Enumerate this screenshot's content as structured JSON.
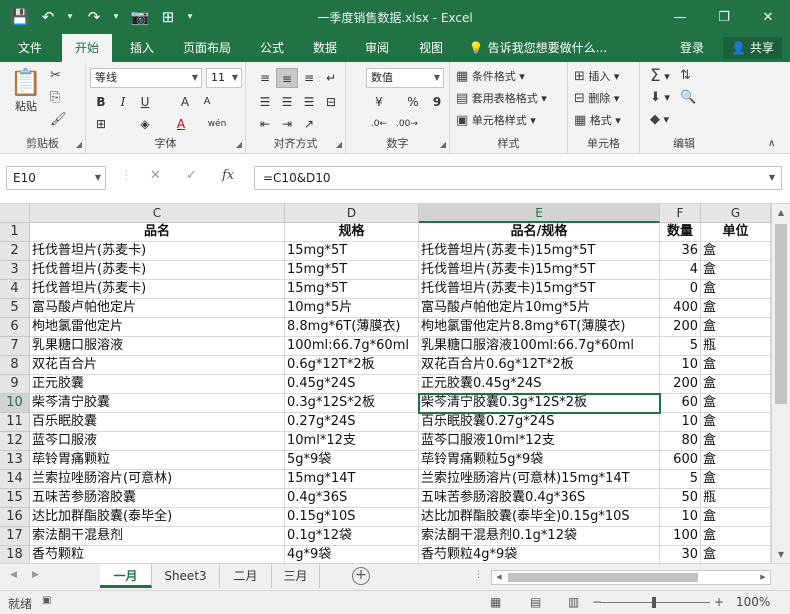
{
  "window": {
    "title": "一季度销售数据.xlsx - Excel",
    "minimize": "—",
    "restore": "❐",
    "close": "✕"
  },
  "qat": {
    "save": "💾",
    "undo": "↶",
    "redo": "↷",
    "camera": "📷",
    "extra": "⊞",
    "more": "▾"
  },
  "tabs": [
    "文件",
    "开始",
    "插入",
    "页面布局",
    "公式",
    "数据",
    "审阅",
    "视图"
  ],
  "tab_active": "开始",
  "tellme": "告诉我您想要做什么...",
  "login": "登录",
  "share": "共享",
  "ribbon": {
    "clipboard": {
      "label": "剪贴板",
      "paste": "粘贴"
    },
    "font": {
      "label": "字体",
      "name": "等线",
      "size": "11",
      "bold": "B",
      "italic": "I",
      "underline": "U",
      "grow": "A",
      "shrink": "A",
      "wen": "wén"
    },
    "align": {
      "label": "对齐方式"
    },
    "number": {
      "label": "数字",
      "format": "数值",
      "percent": "%",
      "comma": "9"
    },
    "styles": {
      "label": "样式",
      "cond": "条件格式",
      "table": "套用表格格式",
      "cell": "单元格样式"
    },
    "cells": {
      "label": "单元格",
      "insert": "插入",
      "delete": "删除",
      "format": "格式"
    },
    "editing": {
      "label": "编辑"
    }
  },
  "formula_bar": {
    "name_box": "E10",
    "cancel": "✕",
    "enter": "✓",
    "fx": "fx",
    "formula": "=C10&D10"
  },
  "grid": {
    "columns": [
      "C",
      "D",
      "E",
      "F",
      "G"
    ],
    "selected_col": "E",
    "selected_row": "10",
    "rows": [
      {
        "n": "1",
        "c": "品名",
        "d": "规格",
        "e": "品名/规格",
        "f": "数量",
        "g": "单位"
      },
      {
        "n": "2",
        "c": "托伐普坦片(苏麦卡)",
        "d": "15mg*5T",
        "e": "托伐普坦片(苏麦卡)15mg*5T",
        "f": "36",
        "g": "盒"
      },
      {
        "n": "3",
        "c": "托伐普坦片(苏麦卡)",
        "d": "15mg*5T",
        "e": "托伐普坦片(苏麦卡)15mg*5T",
        "f": "4",
        "g": "盒"
      },
      {
        "n": "4",
        "c": "托伐普坦片(苏麦卡)",
        "d": "15mg*5T",
        "e": "托伐普坦片(苏麦卡)15mg*5T",
        "f": "0",
        "g": "盒"
      },
      {
        "n": "5",
        "c": "富马酸卢帕他定片",
        "d": "10mg*5片",
        "e": "富马酸卢帕他定片10mg*5片",
        "f": "400",
        "g": "盒"
      },
      {
        "n": "6",
        "c": "枸地氯雷他定片",
        "d": "8.8mg*6T(薄膜衣)",
        "e": "枸地氯雷他定片8.8mg*6T(薄膜衣)",
        "f": "200",
        "g": "盒"
      },
      {
        "n": "7",
        "c": "乳果糖口服溶液",
        "d": "100ml:66.7g*60ml",
        "e": "乳果糖口服溶液100ml:66.7g*60ml",
        "f": "5",
        "g": "瓶"
      },
      {
        "n": "8",
        "c": "双花百合片",
        "d": "0.6g*12T*2板",
        "e": "双花百合片0.6g*12T*2板",
        "f": "10",
        "g": "盒"
      },
      {
        "n": "9",
        "c": "正元胶囊",
        "d": "0.45g*24S",
        "e": "正元胶囊0.45g*24S",
        "f": "200",
        "g": "盒"
      },
      {
        "n": "10",
        "c": "柴芩清宁胶囊",
        "d": "0.3g*12S*2板",
        "e": "柴芩清宁胶囊0.3g*12S*2板",
        "f": "60",
        "g": "盒"
      },
      {
        "n": "11",
        "c": "百乐眠胶囊",
        "d": "0.27g*24S",
        "e": "百乐眠胶囊0.27g*24S",
        "f": "10",
        "g": "盒"
      },
      {
        "n": "12",
        "c": "蓝芩口服液",
        "d": "10ml*12支",
        "e": "蓝芩口服液10ml*12支",
        "f": "80",
        "g": "盒"
      },
      {
        "n": "13",
        "c": "荜铃胃痛颗粒",
        "d": "5g*9袋",
        "e": "荜铃胃痛颗粒5g*9袋",
        "f": "600",
        "g": "盒"
      },
      {
        "n": "14",
        "c": "兰索拉唑肠溶片(可意林)",
        "d": "15mg*14T",
        "e": "兰索拉唑肠溶片(可意林)15mg*14T",
        "f": "5",
        "g": "盒"
      },
      {
        "n": "15",
        "c": "五味苦参肠溶胶囊",
        "d": "0.4g*36S",
        "e": "五味苦参肠溶胶囊0.4g*36S",
        "f": "50",
        "g": "瓶"
      },
      {
        "n": "16",
        "c": "达比加群酯胶囊(泰毕全)",
        "d": "0.15g*10S",
        "e": "达比加群酯胶囊(泰毕全)0.15g*10S",
        "f": "10",
        "g": "盒"
      },
      {
        "n": "17",
        "c": "索法酮干混悬剂",
        "d": "0.1g*12袋",
        "e": "索法酮干混悬剂0.1g*12袋",
        "f": "100",
        "g": "盒"
      },
      {
        "n": "18",
        "c": "香芍颗粒",
        "d": "4g*9袋",
        "e": "香芍颗粒4g*9袋",
        "f": "30",
        "g": "盒"
      }
    ]
  },
  "sheets": [
    "一月",
    "Sheet3",
    "二月",
    "三月"
  ],
  "active_sheet": "一月",
  "add_sheet": "+",
  "status": {
    "ready": "就绪",
    "zoom": "100%",
    "zoom_minus": "−",
    "zoom_plus": "+"
  }
}
